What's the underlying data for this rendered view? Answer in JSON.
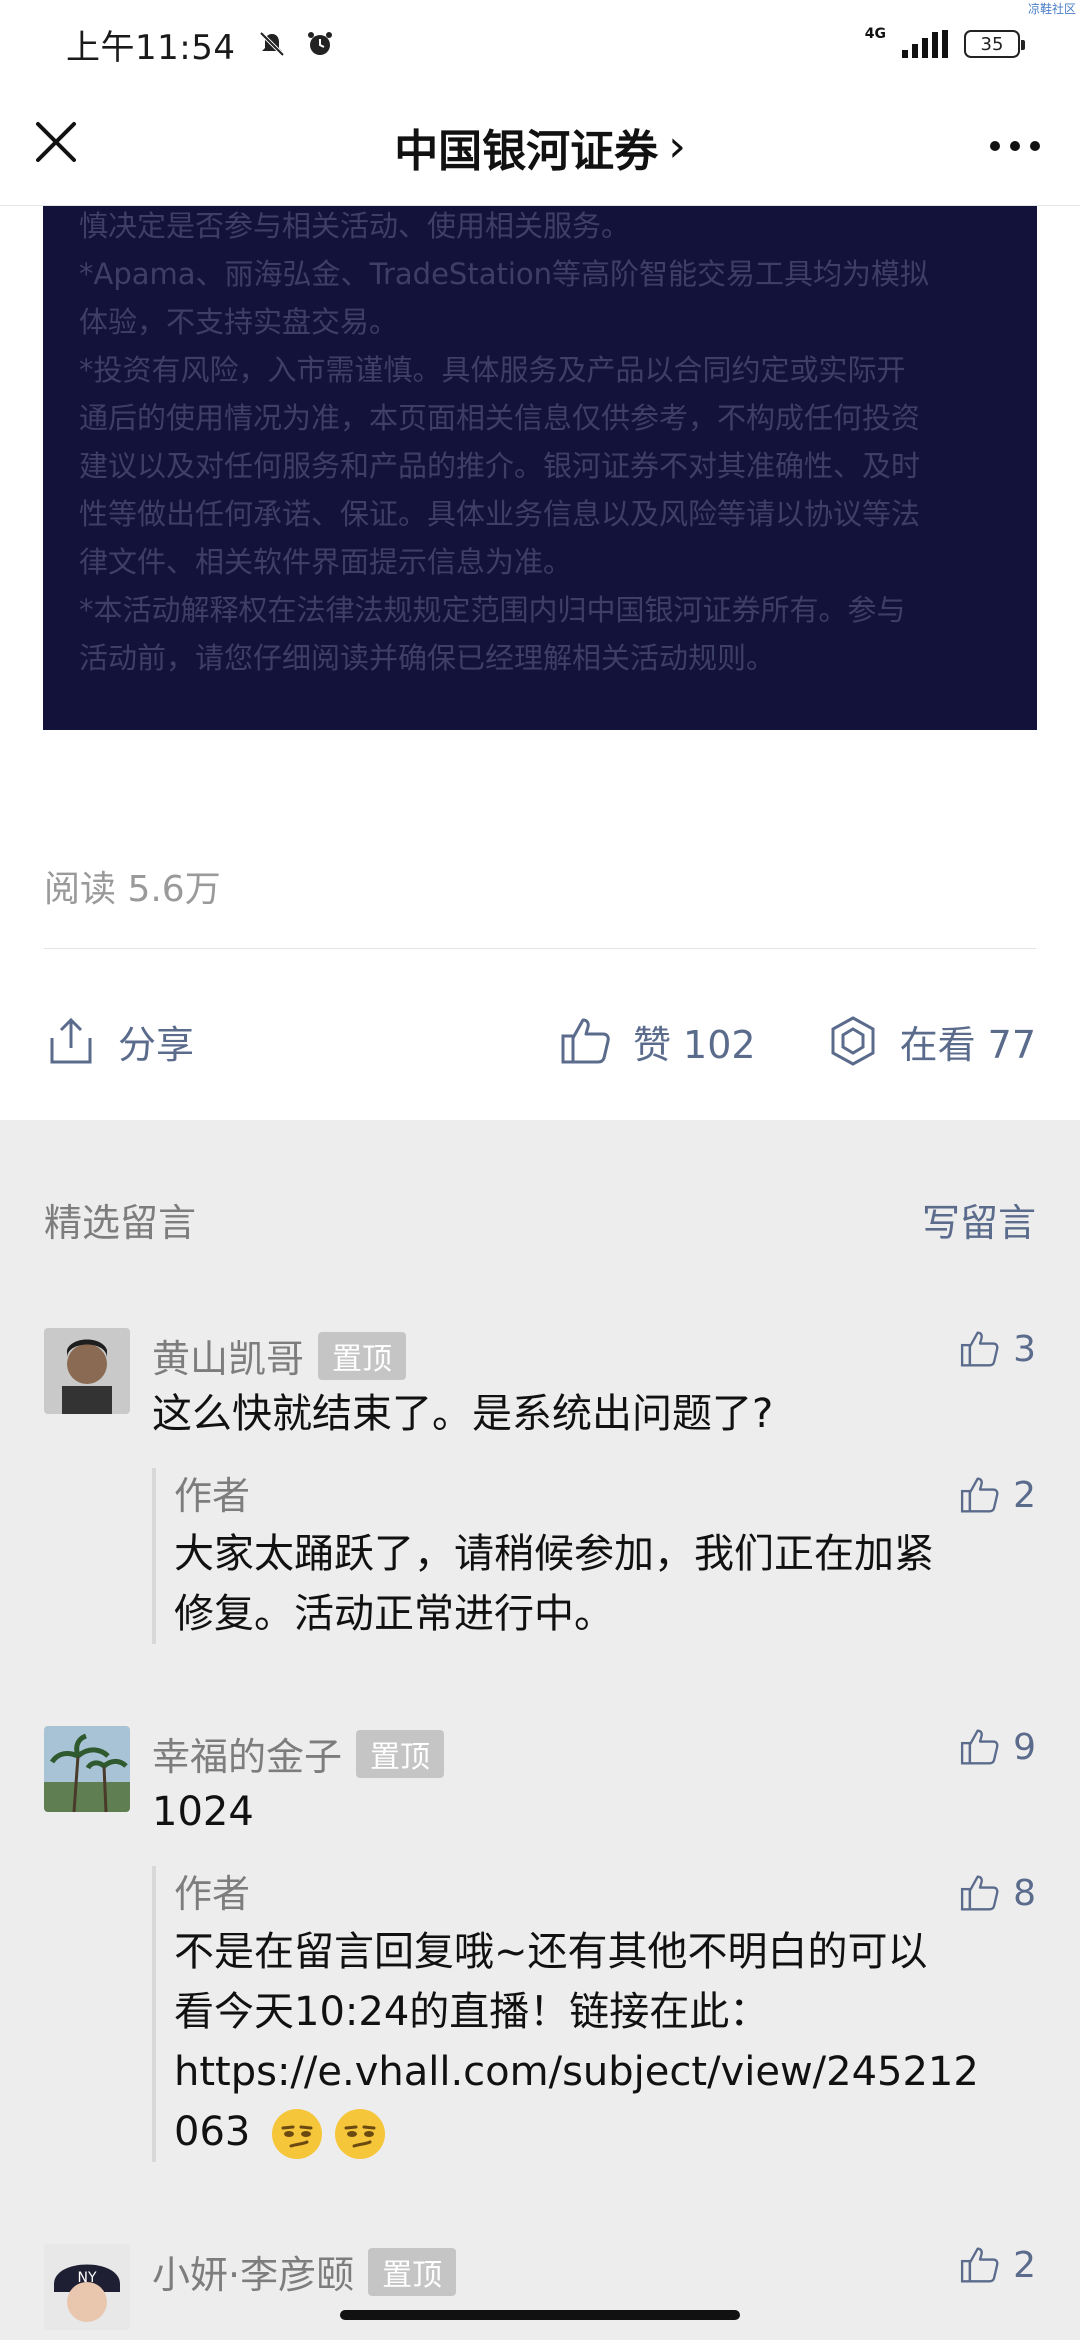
{
  "status_bar": {
    "time": "上午11:54",
    "network": "4G",
    "battery": "35",
    "corner_mark": "凉鞋社区"
  },
  "header": {
    "title": "中国银河证券",
    "chevron": "›"
  },
  "disclaimer": {
    "lines": [
      "慎决定是否参与相关活动、使用相关服务。",
      "*Apama、丽海弘金、TradeStation等高阶智能交易工具均为模拟",
      "体验，不支持实盘交易。",
      "*投资有风险，入市需谨慎。具体服务及产品以合同约定或实际开",
      "通后的使用情况为准，本页面相关信息仅供参考，不构成任何投资",
      "建议以及对任何服务和产品的推介。银河证券不对其准确性、及时",
      "性等做出任何承诺、保证。具体业务信息以及风险等请以协议等法",
      "律文件、相关软件界面提示信息为准。",
      "*本活动解释权在法律法规规定范围内归中国银河证券所有。参与",
      "活动前，请您仔细阅读并确保已经理解相关活动规则。"
    ]
  },
  "stats": {
    "read_count": "阅读 5.6万",
    "share_label": "分享",
    "like_label": "赞 102",
    "watching_label": "在看 77"
  },
  "comments_section": {
    "title": "精选留言",
    "write_label": "写留言",
    "pin_label": "置顶",
    "author_label": "作者",
    "comments": [
      {
        "name": "黄山凯哥",
        "likes": "3",
        "text": "这么快就结束了。是系统出问题了?",
        "reply": {
          "likes": "2",
          "lines": [
            "大家太踊跃了，请稍候参加，我们正在加紧",
            "修复。活动正常进行中。"
          ]
        }
      },
      {
        "name": "幸福的金子",
        "likes": "9",
        "text": "1024",
        "reply": {
          "likes": "8",
          "lines": [
            "不是在留言回复哦~还有其他不明白的可以",
            "看今天10:24的直播！链接在此：",
            "https://e.vhall.com/subject/view/245212",
            "063"
          ]
        }
      },
      {
        "name": "小妍·李彦颐",
        "likes": "2"
      }
    ]
  },
  "icons": {
    "close": "close-icon",
    "more": "more-icon",
    "share": "share-icon",
    "like": "thumbs-up-icon",
    "watching": "watching-icon",
    "emoji": "smirk-emoji-icon"
  },
  "colors": {
    "disclaimer_bg": "#13123a",
    "link_blue": "#5b6b8c",
    "gray_text": "#7d7d7d"
  }
}
